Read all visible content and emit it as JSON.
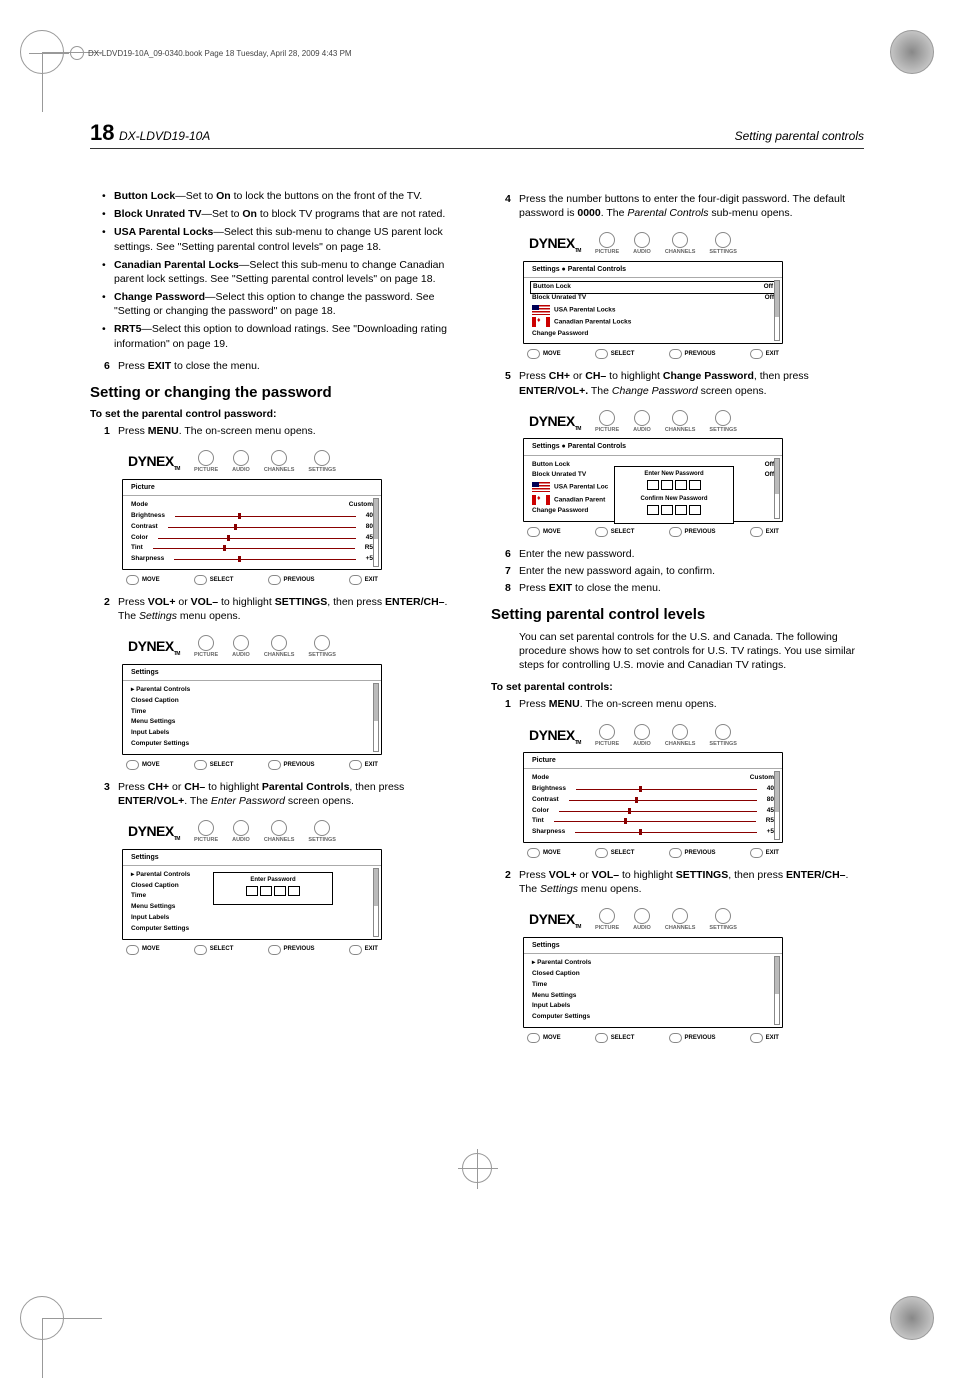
{
  "topbar_note": "DX-LDVD19-10A_09-0340.book  Page 18  Tuesday, April 28, 2009  4:43 PM",
  "page_number": "18",
  "model": "DX-LDVD19-10A",
  "running_head": "Setting parental controls",
  "left": {
    "bullets": [
      {
        "label": "Button Lock",
        "rest": "—Set to ",
        "opt": "On",
        "rest2": " to lock the buttons on the front of the TV."
      },
      {
        "label": "Block Unrated TV",
        "rest": "—Set to ",
        "opt": "On",
        "rest2": " to block TV programs that are not rated."
      },
      {
        "label": "USA Parental Locks",
        "rest": "—Select this sub-menu to change US parent lock settings. See \"Setting parental control levels\" on page 18.",
        "opt": "",
        "rest2": ""
      },
      {
        "label": "Canadian Parental Locks",
        "rest": "—Select this sub-menu to change Canadian parent lock settings. See \"Setting parental control levels\" on page 18.",
        "opt": "",
        "rest2": ""
      },
      {
        "label": "Change Password",
        "rest": "—Select this option to change the password. See \"Setting or changing the password\" on page 18.",
        "opt": "",
        "rest2": ""
      },
      {
        "label": "RRT5",
        "rest": "—Select this option to download ratings. See \"Downloading rating information\" on page 19.",
        "opt": "",
        "rest2": ""
      }
    ],
    "step6": {
      "num": "6",
      "pre": "Press ",
      "btn": "EXIT",
      "post": " to close the menu."
    },
    "h2": "Setting or changing the password",
    "h3": "To set the parental control password:",
    "step1": {
      "num": "1",
      "pre": "Press ",
      "btn": "MENU",
      "post": ". The on-screen menu opens."
    },
    "step2": {
      "num": "2",
      "pre": "Press ",
      "b1": "VOL+",
      "mid": " or ",
      "b2": "VOL–",
      "mid2": " to highlight ",
      "b3": "SETTINGS",
      "mid3": ", then press ",
      "b4": "ENTER/CH–",
      "post": ". The ",
      "ital": "Settings",
      "post2": " menu opens."
    },
    "step3": {
      "num": "3",
      "pre": "Press ",
      "b1": "CH+",
      "mid": " or ",
      "b2": "CH–",
      "mid2": " to highlight ",
      "b3": "Parental Controls",
      "mid3": ", then press ",
      "b4": "ENTER/VOL+",
      "post": ". The ",
      "ital": "Enter Password",
      "post2": " screen opens."
    }
  },
  "right": {
    "step4": {
      "num": "4",
      "pre": "Press the number buttons to enter the four-digit password. The default password is ",
      "b1": "0000",
      "post": ". The ",
      "ital": "Parental Controls",
      "post2": " sub-menu opens."
    },
    "step5": {
      "num": "5",
      "pre": "Press ",
      "b1": "CH+",
      "mid": " or ",
      "b2": "CH–",
      "mid2": " to highlight ",
      "b3": "Change Password",
      "mid3": ", then press ",
      "b4": "ENTER/VOL+.",
      "post": " The ",
      "ital": "Change Password",
      "post2": " screen opens."
    },
    "step6": {
      "num": "6",
      "txt": "Enter the new password."
    },
    "step7": {
      "num": "7",
      "txt": "Enter the new password again, to confirm."
    },
    "step8": {
      "num": "8",
      "pre": "Press ",
      "btn": "EXIT",
      "post": " to close the menu."
    },
    "h2": "Setting parental control levels",
    "intro": "You can set parental controls for the U.S. and Canada. The following procedure shows how to set controls for U.S. TV ratings. You use similar steps for controlling U.S. movie and Canadian TV ratings.",
    "h3": "To set parental controls:",
    "step1": {
      "num": "1",
      "pre": "Press ",
      "btn": "MENU",
      "post": ". The on-screen menu opens."
    },
    "step2": {
      "num": "2",
      "pre": "Press ",
      "b1": "VOL+",
      "mid": " or ",
      "b2": "VOL–",
      "mid2": " to highlight ",
      "b3": "SETTINGS",
      "mid3": ", then press ",
      "b4": "ENTER/CH–",
      "post": ". The ",
      "ital": "Settings",
      "post2": " menu opens."
    }
  },
  "osd": {
    "logo": "DYNEX",
    "tm": "TM",
    "tabs": [
      "PICTURE",
      "AUDIO",
      "CHANNELS",
      "SETTINGS"
    ],
    "footer": [
      "MOVE",
      "SELECT",
      "PREVIOUS",
      "EXIT"
    ],
    "picture": {
      "title": "Picture",
      "rows": [
        {
          "k": "Mode",
          "v": "Custom"
        },
        {
          "k": "Brightness",
          "v": "40"
        },
        {
          "k": "Contrast",
          "v": "80"
        },
        {
          "k": "Color",
          "v": "45"
        },
        {
          "k": "Tint",
          "v": "R5"
        },
        {
          "k": "Sharpness",
          "v": "+5"
        }
      ]
    },
    "settings": {
      "title": "Settings",
      "items": [
        "Parental Controls",
        "Closed Caption",
        "Time",
        "Menu Settings",
        "Input Labels",
        "Computer Settings"
      ]
    },
    "enterpw": {
      "title": "Settings",
      "overlay": "Enter Password"
    },
    "parental": {
      "title": "Settings ● Parental Controls",
      "rows": [
        {
          "k": "Button Lock",
          "v": "Off"
        },
        {
          "k": "Block Unrated TV",
          "v": "Off"
        }
      ],
      "sub": [
        "USA Parental Locks",
        "Canadian Parental Locks",
        "Change Password"
      ]
    },
    "newpw": {
      "ov1": "Enter New Password",
      "ov2": "Confirm New Password"
    }
  }
}
